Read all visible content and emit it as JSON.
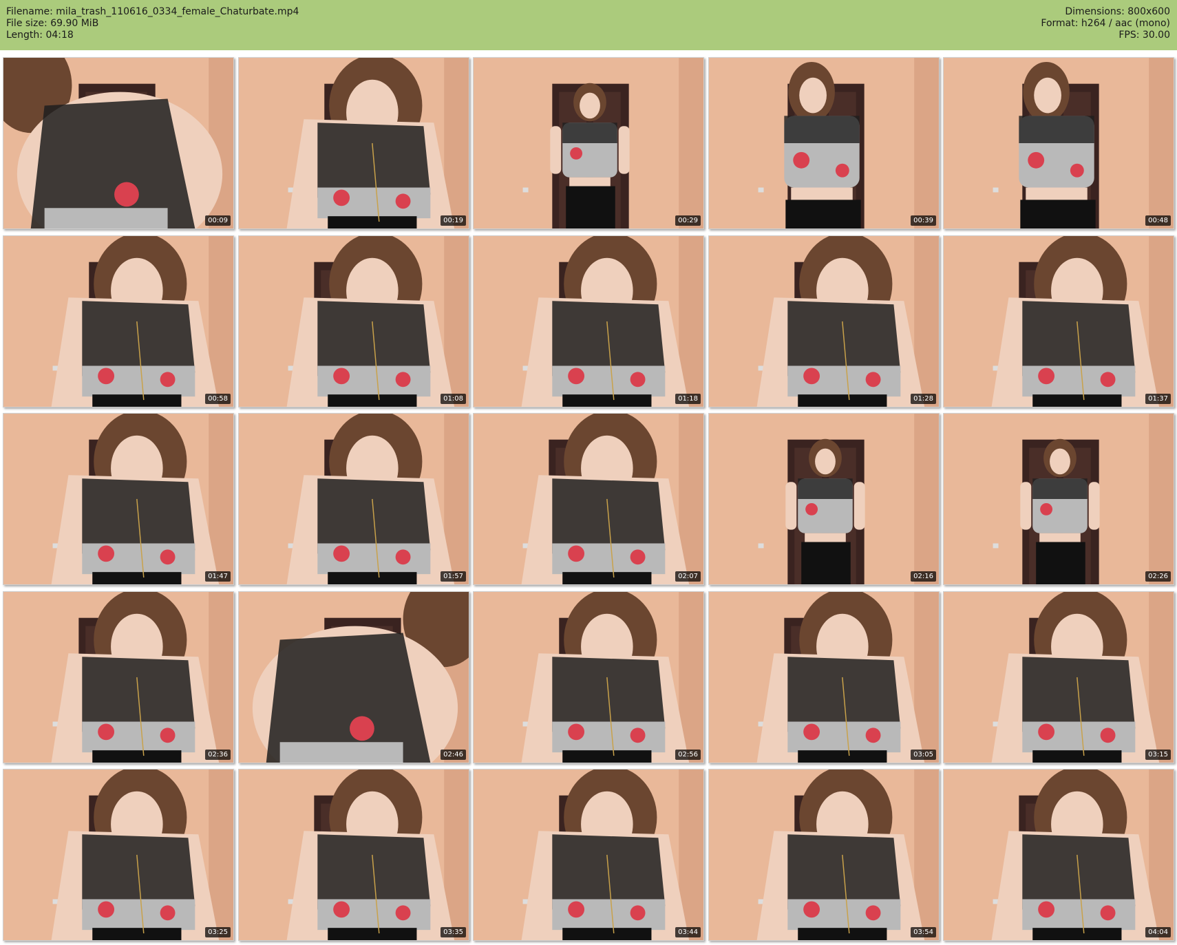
{
  "header": {
    "left_lines": [
      "Filename: mila_trash_110616_0334_female_Chaturbate.mp4",
      "File size: 69.90 MiB",
      "Length: 04:18"
    ],
    "right_lines": [
      "Dimensions: 800x600",
      "Format: h264 / aac (mono)",
      "FPS: 30.00"
    ],
    "background": "#abcb7c"
  },
  "grid": {
    "rows": 5,
    "cols": 5
  },
  "thumbnails": [
    {
      "timestamp": "00:09",
      "pose": "lean-close"
    },
    {
      "timestamp": "00:19",
      "pose": "lean"
    },
    {
      "timestamp": "00:29",
      "pose": "standing"
    },
    {
      "timestamp": "00:39",
      "pose": "standing-near"
    },
    {
      "timestamp": "00:48",
      "pose": "standing-near"
    },
    {
      "timestamp": "00:58",
      "pose": "lean"
    },
    {
      "timestamp": "01:08",
      "pose": "lean"
    },
    {
      "timestamp": "01:18",
      "pose": "lean"
    },
    {
      "timestamp": "01:28",
      "pose": "lean"
    },
    {
      "timestamp": "01:37",
      "pose": "lean"
    },
    {
      "timestamp": "01:47",
      "pose": "lean"
    },
    {
      "timestamp": "01:57",
      "pose": "lean"
    },
    {
      "timestamp": "02:07",
      "pose": "lean"
    },
    {
      "timestamp": "02:16",
      "pose": "standing"
    },
    {
      "timestamp": "02:26",
      "pose": "standing"
    },
    {
      "timestamp": "02:36",
      "pose": "lean"
    },
    {
      "timestamp": "02:46",
      "pose": "lean-close"
    },
    {
      "timestamp": "02:56",
      "pose": "lean"
    },
    {
      "timestamp": "03:05",
      "pose": "lean"
    },
    {
      "timestamp": "03:15",
      "pose": "lean"
    },
    {
      "timestamp": "03:25",
      "pose": "lean"
    },
    {
      "timestamp": "03:35",
      "pose": "lean"
    },
    {
      "timestamp": "03:44",
      "pose": "lean"
    },
    {
      "timestamp": "03:54",
      "pose": "lean"
    },
    {
      "timestamp": "04:04",
      "pose": "lean"
    }
  ],
  "colors": {
    "wall": "#e9b899",
    "wall_shadow": "#dba586",
    "door": "#3a2320",
    "hair": "#6b4630",
    "skin": "#efd0bd",
    "top": "#b9b9b9",
    "heart": "#d9414f",
    "mesh": "#1e1e1e"
  }
}
